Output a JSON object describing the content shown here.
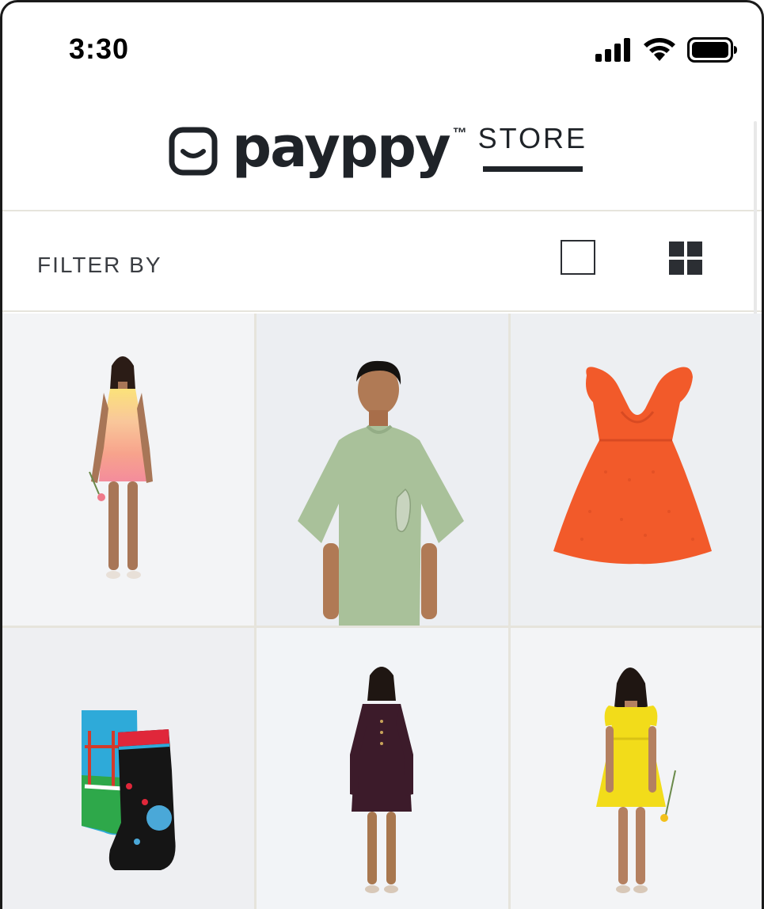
{
  "status_bar": {
    "time": "3:30",
    "icons": [
      "signal-icon",
      "wifi-icon",
      "battery-icon"
    ]
  },
  "header": {
    "brand_name": "payppy",
    "trademark": "™",
    "store_label": "STORE"
  },
  "filter_bar": {
    "filter_label": "FILTER BY",
    "view_options": [
      "single-view-icon",
      "grid-view-icon"
    ]
  },
  "products": [
    {
      "description_icon": "woman-gradient-dress-image"
    },
    {
      "description_icon": "man-green-tshirt-image"
    },
    {
      "description_icon": "orange-dress-image"
    },
    {
      "description_icon": "printed-socks-image"
    },
    {
      "description_icon": "woman-maroon-dress-image"
    },
    {
      "description_icon": "woman-yellow-dress-image"
    }
  ],
  "colors": {
    "text": "#1f2328",
    "divider": "#e6e4dc",
    "tile_bg": "#eef0f3"
  }
}
